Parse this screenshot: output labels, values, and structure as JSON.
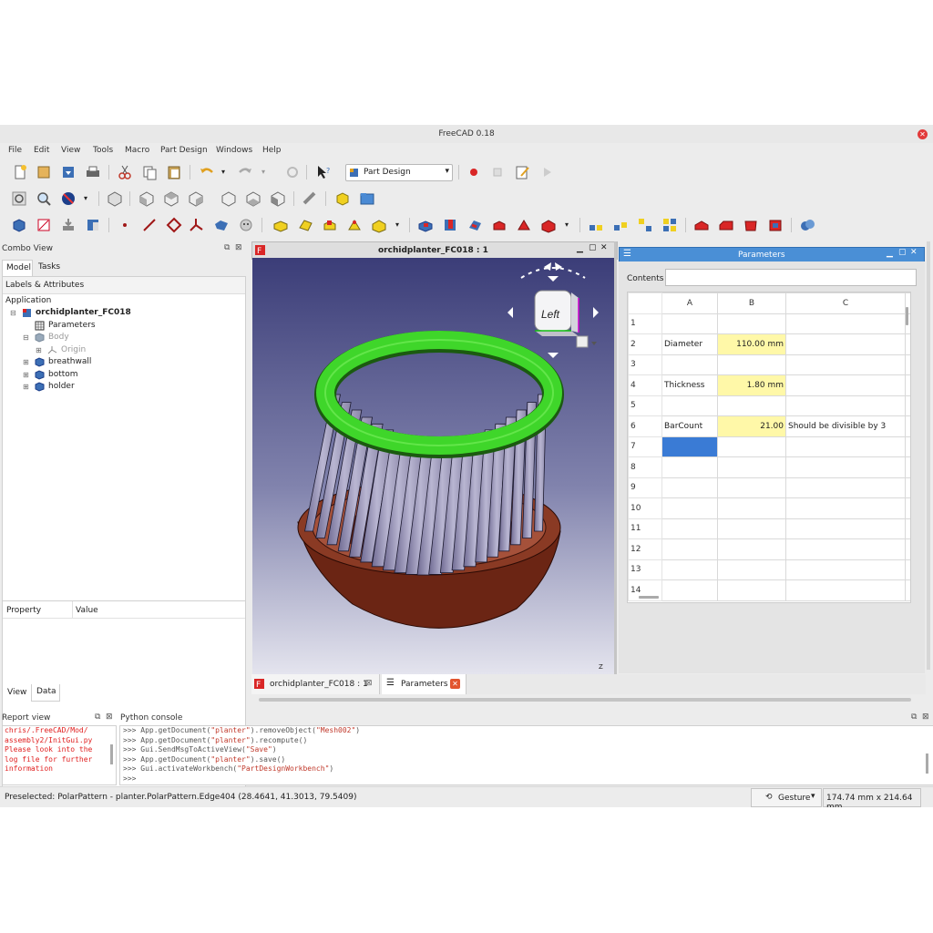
{
  "window": {
    "title": "FreeCAD 0.18"
  },
  "menu": [
    "File",
    "Edit",
    "View",
    "Tools",
    "Macro",
    "Part Design",
    "Windows",
    "Help"
  ],
  "toolbar": {
    "workbench": "Part Design"
  },
  "combo_view": {
    "title": "Combo View",
    "tabs": [
      "Model",
      "Tasks"
    ],
    "section_label": "Labels & Attributes",
    "app_label": "Application",
    "tree": [
      {
        "label": "orchidplanter_FC018",
        "icon": "document-icon",
        "indent": 0,
        "bold": true
      },
      {
        "label": "Parameters",
        "icon": "spreadsheet-icon",
        "indent": 1,
        "bold": false
      },
      {
        "label": "Body",
        "icon": "body-icon",
        "indent": 1,
        "bold": false,
        "grey": true
      },
      {
        "label": "Origin",
        "icon": "origin-icon",
        "indent": 2,
        "bold": false,
        "grey": true
      },
      {
        "label": "breathwall",
        "icon": "part-icon",
        "indent": 1,
        "bold": false
      },
      {
        "label": "bottom",
        "icon": "part-icon",
        "indent": 1,
        "bold": false
      },
      {
        "label": "holder",
        "icon": "part-icon",
        "indent": 1,
        "bold": false
      }
    ],
    "property_headers": [
      "Property",
      "Value"
    ],
    "bottom_tabs": [
      "View",
      "Data"
    ]
  },
  "viewport": {
    "title": "orchidplanter_FC018 : 1",
    "navcube_face": "Left",
    "axis_label": "Z"
  },
  "spreadsheet": {
    "title": "Parameters",
    "contents_label": "Contents",
    "contents_value": "",
    "columns": [
      "A",
      "B",
      "C"
    ],
    "rows": [
      {
        "n": "1",
        "a": "",
        "b": "",
        "c": ""
      },
      {
        "n": "2",
        "a": "Diameter",
        "b": "110.00 mm",
        "c": ""
      },
      {
        "n": "3",
        "a": "",
        "b": "",
        "c": ""
      },
      {
        "n": "4",
        "a": "Thickness",
        "b": "1.80 mm",
        "c": ""
      },
      {
        "n": "5",
        "a": "",
        "b": "",
        "c": ""
      },
      {
        "n": "6",
        "a": "BarCount",
        "b": "21.00",
        "c": "Should be divisible by 3"
      },
      {
        "n": "7",
        "a": "",
        "b": "",
        "c": ""
      },
      {
        "n": "8",
        "a": "",
        "b": "",
        "c": ""
      },
      {
        "n": "9",
        "a": "",
        "b": "",
        "c": ""
      },
      {
        "n": "10",
        "a": "",
        "b": "",
        "c": ""
      },
      {
        "n": "11",
        "a": "",
        "b": "",
        "c": ""
      },
      {
        "n": "12",
        "a": "",
        "b": "",
        "c": ""
      },
      {
        "n": "13",
        "a": "",
        "b": "",
        "c": ""
      },
      {
        "n": "14",
        "a": "",
        "b": "",
        "c": ""
      }
    ]
  },
  "doc_tabs": [
    {
      "label": "orchidplanter_FC018 : 1"
    },
    {
      "label": "Parameters"
    }
  ],
  "report_view": {
    "title": "Report view",
    "lines": [
      "chris/.FreeCAD/Mod/",
      "assembly2/InitGui.py",
      "Please look into the",
      "log file for further",
      "information"
    ]
  },
  "python_console": {
    "title": "Python console",
    "lines": [
      ">>> App.getDocument(\"planter\").removeObject(\"Mesh002\")",
      ">>> App.getDocument(\"planter\").recompute()",
      ">>> Gui.SendMsgToActiveView(\"Save\")",
      ">>> App.getDocument(\"planter\").save()",
      ">>> Gui.activateWorkbench(\"PartDesignWorkbench\")",
      ">>>"
    ]
  },
  "statusbar": {
    "message": "Preselected: PolarPattern - planter.PolarPattern.Edge404 (28.4641, 41.3013, 79.5409)",
    "nav_style": "Gesture",
    "dimensions": "174.74 mm x 214.64 mm"
  },
  "colors": {
    "accent": "#3a7bd5",
    "ring": "#3fd62a",
    "bars": "#a6a2c2",
    "base": "#7a2f1c",
    "viewport_top": "#3b3d78",
    "viewport_bottom": "#e4e4ee"
  }
}
